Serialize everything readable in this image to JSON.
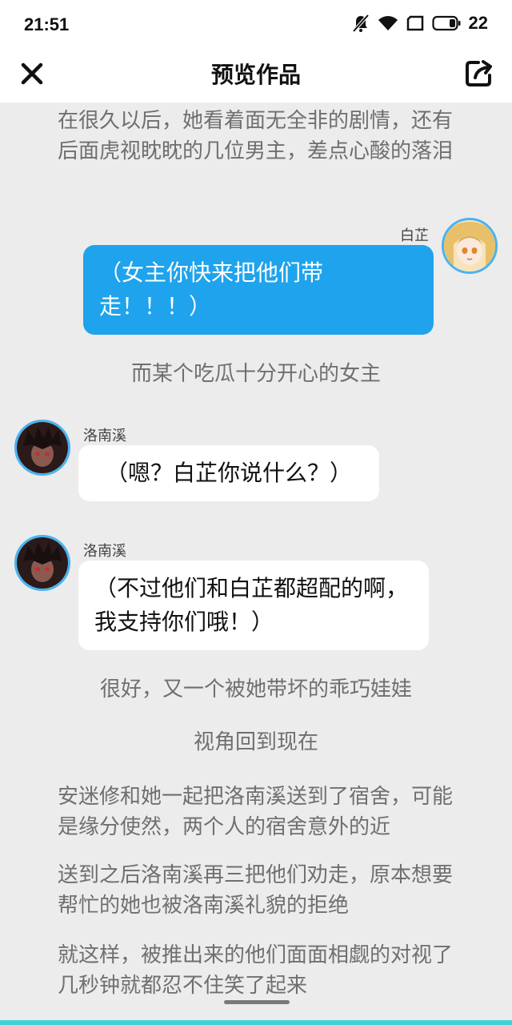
{
  "status_bar": {
    "time": "21:51",
    "battery": "22"
  },
  "header": {
    "title": "预览作品"
  },
  "story": {
    "intro": "在很久以后，她看着面无全非的剧情，还有后面虎视眈眈的几位男主，差点心酸的落泪",
    "msg1": {
      "speaker": "白芷",
      "text": "（女主你快来把他们带走！！！）"
    },
    "narr1": "而某个吃瓜十分开心的女主",
    "msg2": {
      "speaker": "洛南溪",
      "text": "（嗯？白芷你说什么？）"
    },
    "msg3": {
      "speaker": "洛南溪",
      "text": "（不过他们和白芷都超配的啊，我支持你们哦！）"
    },
    "narr2": "很好，又一个被她带坏的乖巧娃娃",
    "narr3": "视角回到现在",
    "para1": "安迷修和她一起把洛南溪送到了宿舍，可能是缘分使然，两个人的宿舍意外的近",
    "para2": "送到之后洛南溪再三把他们劝走，原本想要帮忙的她也被洛南溪礼貌的拒绝",
    "para3": "就这样，被推出来的他们面面相觑的对视了几秒钟就都忍不住笑了起来"
  },
  "colors": {
    "accent_blue": "#1fa3ec",
    "avatar_ring": "#48b3f1",
    "bottom_bar": "#3fd3d6"
  },
  "icons": [
    "close-icon",
    "share-icon",
    "mute-icon",
    "wifi-icon",
    "screen-icon",
    "battery-icon"
  ]
}
